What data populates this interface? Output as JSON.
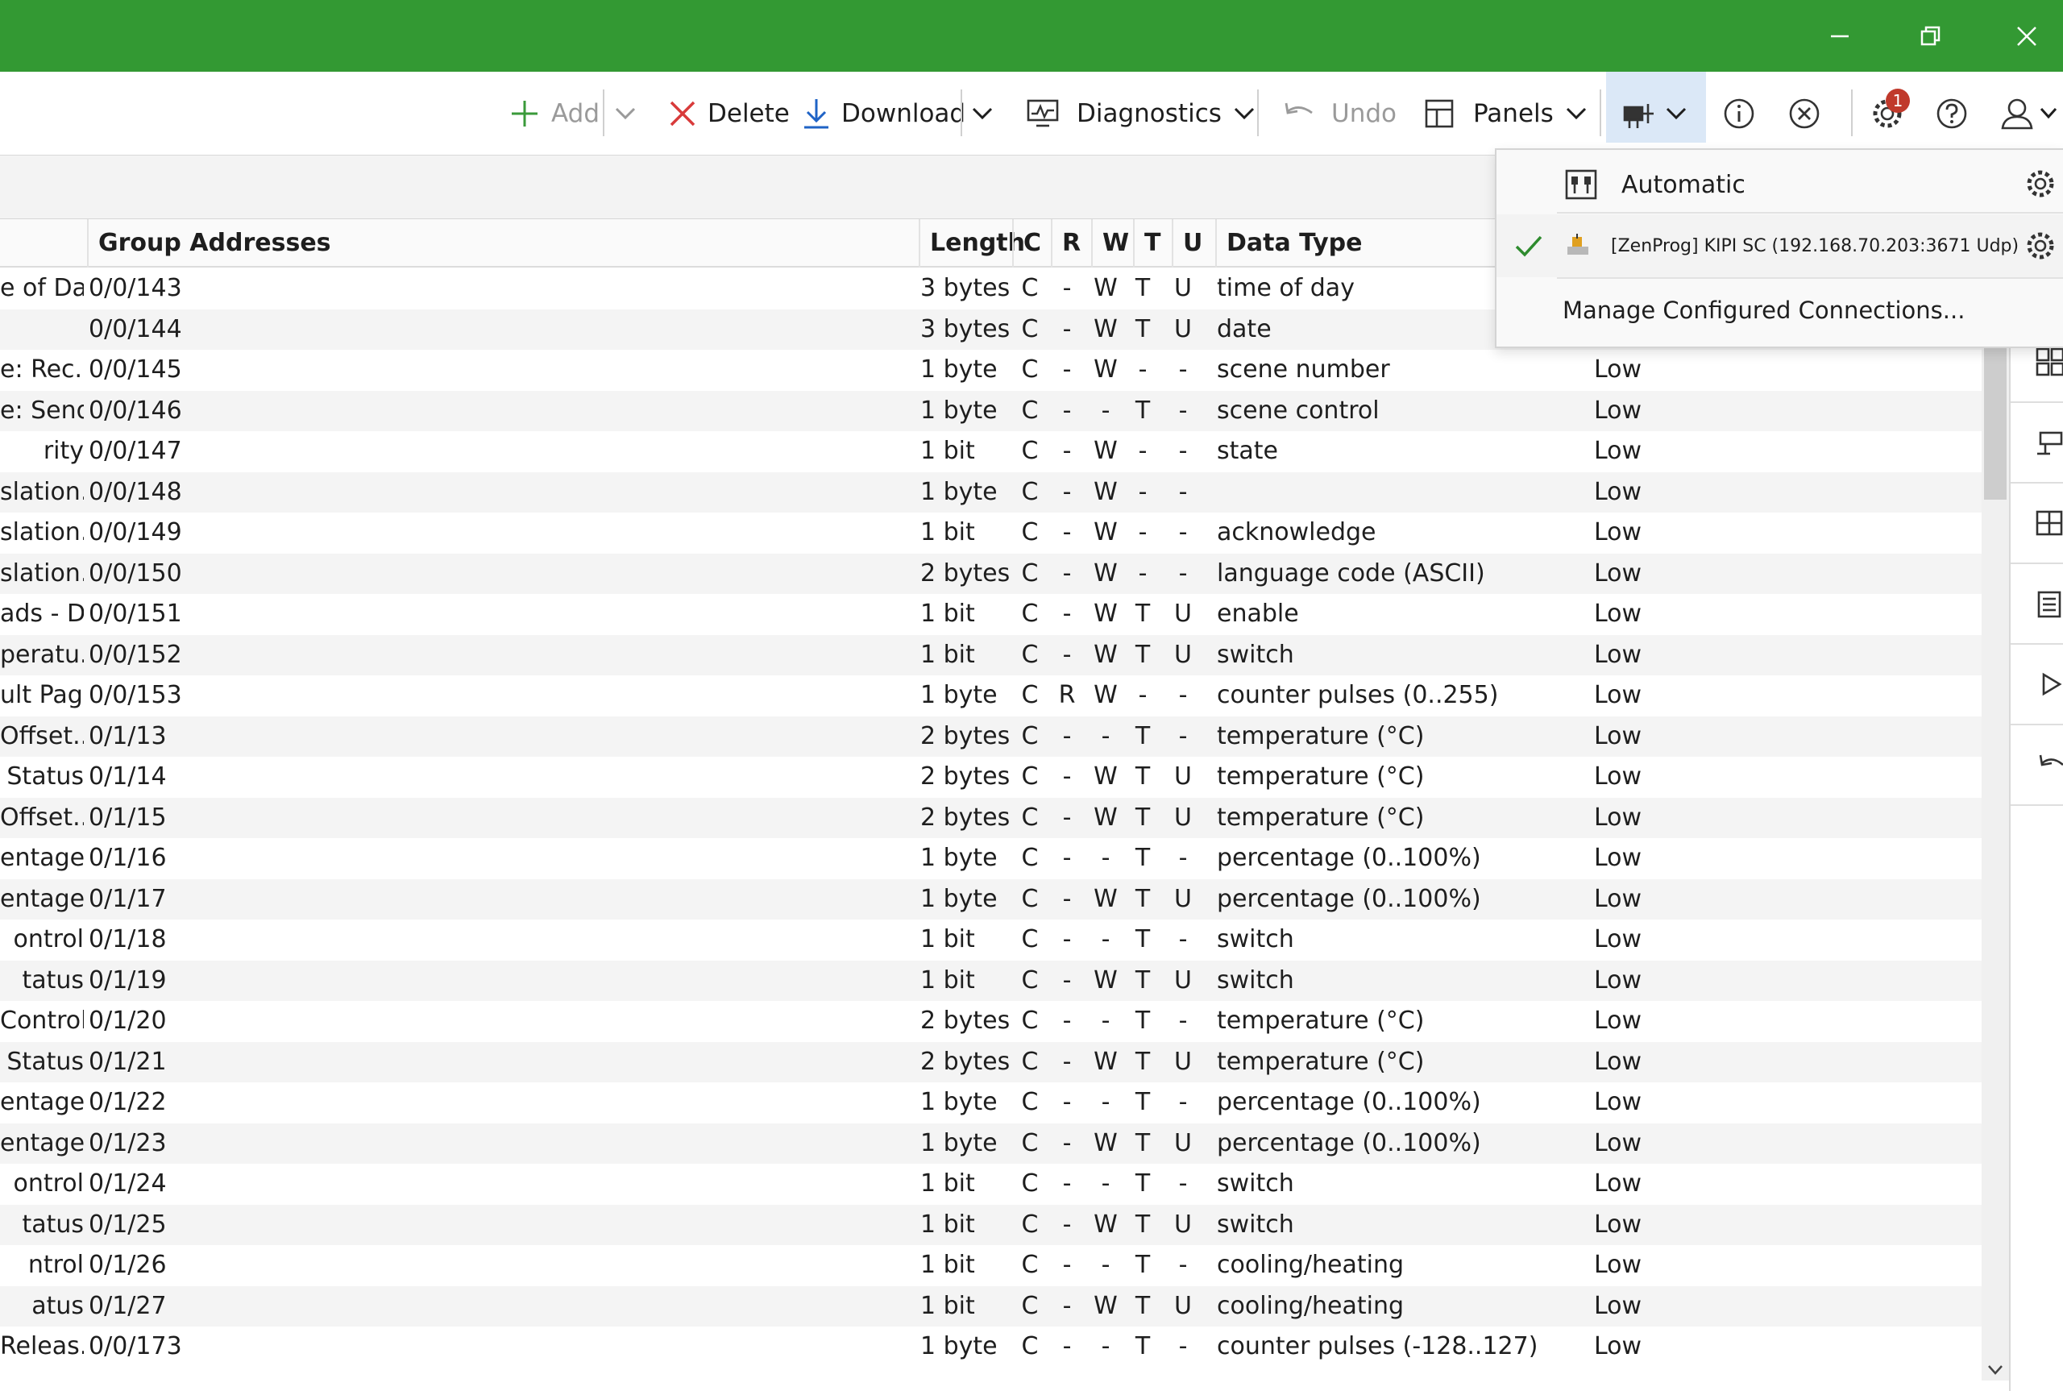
{
  "toolbar": {
    "add": "Add",
    "delete": "Delete",
    "download": "Download",
    "diagnostics": "Diagnostics",
    "undo": "Undo",
    "panels": "Panels",
    "notification_count": "1"
  },
  "columns": {
    "group_addresses": "Group Addresses",
    "length": "Length",
    "c": "C",
    "r": "R",
    "w": "W",
    "t": "T",
    "u": "U",
    "data_type": "Data Type"
  },
  "rows": [
    {
      "name": "e of Day",
      "address": "0/0/143",
      "length": "3 bytes",
      "c": "C",
      "r": "-",
      "w": "W",
      "t": "T",
      "u": "U",
      "type": "time of day",
      "priority": ""
    },
    {
      "name": "",
      "address": "0/0/144",
      "length": "3 bytes",
      "c": "C",
      "r": "-",
      "w": "W",
      "t": "T",
      "u": "U",
      "type": "date",
      "priority": ""
    },
    {
      "name": "e: Rec...",
      "address": "0/0/145",
      "length": "1 byte",
      "c": "C",
      "r": "-",
      "w": "W",
      "t": "-",
      "u": "-",
      "type": "scene number",
      "priority": "Low"
    },
    {
      "name": "e: Send",
      "address": "0/0/146",
      "length": "1 byte",
      "c": "C",
      "r": "-",
      "w": "-",
      "t": "T",
      "u": "-",
      "type": "scene control",
      "priority": "Low"
    },
    {
      "name": "rity",
      "address": "0/0/147",
      "length": "1 bit",
      "c": "C",
      "r": "-",
      "w": "W",
      "t": "-",
      "u": "-",
      "type": "state",
      "priority": "Low"
    },
    {
      "name": "slation...",
      "address": "0/0/148",
      "length": "1 byte",
      "c": "C",
      "r": "-",
      "w": "W",
      "t": "-",
      "u": "-",
      "type": "",
      "priority": "Low"
    },
    {
      "name": "slation...",
      "address": "0/0/149",
      "length": "1 bit",
      "c": "C",
      "r": "-",
      "w": "W",
      "t": "-",
      "u": "-",
      "type": "acknowledge",
      "priority": "Low"
    },
    {
      "name": "slation...",
      "address": "0/0/150",
      "length": "2 bytes",
      "c": "C",
      "r": "-",
      "w": "W",
      "t": "-",
      "u": "-",
      "type": "language code (ASCII)",
      "priority": "Low"
    },
    {
      "name": "ads - D...",
      "address": "0/0/151",
      "length": "1 bit",
      "c": "C",
      "r": "-",
      "w": "W",
      "t": "T",
      "u": "U",
      "type": "enable",
      "priority": "Low"
    },
    {
      "name": "peratu...",
      "address": "0/0/152",
      "length": "1 bit",
      "c": "C",
      "r": "-",
      "w": "W",
      "t": "T",
      "u": "U",
      "type": "switch",
      "priority": "Low"
    },
    {
      "name": "ult Page",
      "address": "0/0/153",
      "length": "1 byte",
      "c": "C",
      "r": "R",
      "w": "W",
      "t": "-",
      "u": "-",
      "type": "counter pulses (0..255)",
      "priority": "Low"
    },
    {
      "name": "Offset...",
      "address": "0/1/13",
      "length": "2 bytes",
      "c": "C",
      "r": "-",
      "w": "-",
      "t": "T",
      "u": "-",
      "type": "temperature (°C)",
      "priority": "Low"
    },
    {
      "name": "Status",
      "address": "0/1/14",
      "length": "2 bytes",
      "c": "C",
      "r": "-",
      "w": "W",
      "t": "T",
      "u": "U",
      "type": "temperature (°C)",
      "priority": "Low"
    },
    {
      "name": "Offset...",
      "address": "0/1/15",
      "length": "2 bytes",
      "c": "C",
      "r": "-",
      "w": "W",
      "t": "T",
      "u": "U",
      "type": "temperature (°C)",
      "priority": "Low"
    },
    {
      "name": "entage...",
      "address": "0/1/16",
      "length": "1 byte",
      "c": "C",
      "r": "-",
      "w": "-",
      "t": "T",
      "u": "-",
      "type": "percentage (0..100%)",
      "priority": "Low"
    },
    {
      "name": "entage...",
      "address": "0/1/17",
      "length": "1 byte",
      "c": "C",
      "r": "-",
      "w": "W",
      "t": "T",
      "u": "U",
      "type": "percentage (0..100%)",
      "priority": "Low"
    },
    {
      "name": "ontrol",
      "address": "0/1/18",
      "length": "1 bit",
      "c": "C",
      "r": "-",
      "w": "-",
      "t": "T",
      "u": "-",
      "type": "switch",
      "priority": "Low"
    },
    {
      "name": "tatus",
      "address": "0/1/19",
      "length": "1 bit",
      "c": "C",
      "r": "-",
      "w": "W",
      "t": "T",
      "u": "U",
      "type": "switch",
      "priority": "Low"
    },
    {
      "name": "Control",
      "address": "0/1/20",
      "length": "2 bytes",
      "c": "C",
      "r": "-",
      "w": "-",
      "t": "T",
      "u": "-",
      "type": "temperature (°C)",
      "priority": "Low"
    },
    {
      "name": "Status",
      "address": "0/1/21",
      "length": "2 bytes",
      "c": "C",
      "r": "-",
      "w": "W",
      "t": "T",
      "u": "U",
      "type": "temperature (°C)",
      "priority": "Low"
    },
    {
      "name": "entage...",
      "address": "0/1/22",
      "length": "1 byte",
      "c": "C",
      "r": "-",
      "w": "-",
      "t": "T",
      "u": "-",
      "type": "percentage (0..100%)",
      "priority": "Low"
    },
    {
      "name": "entage...",
      "address": "0/1/23",
      "length": "1 byte",
      "c": "C",
      "r": "-",
      "w": "W",
      "t": "T",
      "u": "U",
      "type": "percentage (0..100%)",
      "priority": "Low"
    },
    {
      "name": "ontrol",
      "address": "0/1/24",
      "length": "1 bit",
      "c": "C",
      "r": "-",
      "w": "-",
      "t": "T",
      "u": "-",
      "type": "switch",
      "priority": "Low"
    },
    {
      "name": "tatus",
      "address": "0/1/25",
      "length": "1 bit",
      "c": "C",
      "r": "-",
      "w": "W",
      "t": "T",
      "u": "U",
      "type": "switch",
      "priority": "Low"
    },
    {
      "name": "ntrol",
      "address": "0/1/26",
      "length": "1 bit",
      "c": "C",
      "r": "-",
      "w": "-",
      "t": "T",
      "u": "-",
      "type": "cooling/heating",
      "priority": "Low"
    },
    {
      "name": "atus",
      "address": "0/1/27",
      "length": "1 bit",
      "c": "C",
      "r": "-",
      "w": "W",
      "t": "T",
      "u": "U",
      "type": "cooling/heating",
      "priority": "Low"
    },
    {
      "name": "Releas...",
      "address": "0/0/173",
      "length": "1 byte",
      "c": "C",
      "r": "-",
      "w": "-",
      "t": "T",
      "u": "-",
      "type": "counter pulses (-128..127)",
      "priority": "Low"
    }
  ],
  "connection_menu": {
    "automatic": "Automatic",
    "selected_connection": "[ZenProg] KIPI SC (192.168.70.203:3671 Udp)",
    "manage": "Manage Configured Connections..."
  },
  "colors": {
    "title_bar": "#339933",
    "add_icon": "#3a9a3a",
    "delete_icon": "#d83b3b",
    "download_icon": "#1f63c6",
    "check": "#2e8b2e",
    "badge": "#c0392b"
  }
}
